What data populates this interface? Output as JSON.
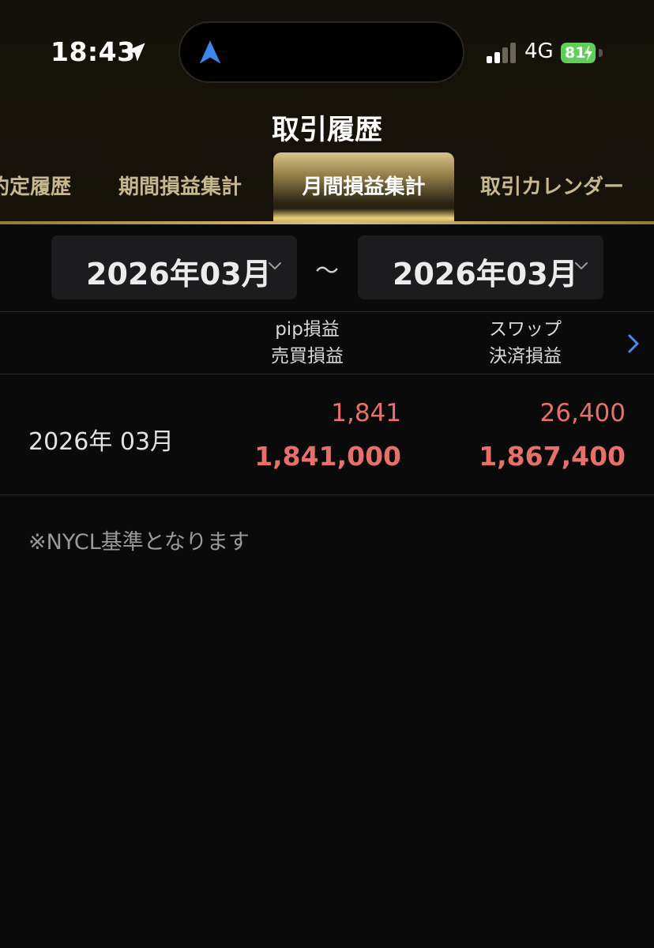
{
  "status_bar": {
    "time": "18:43",
    "network": "4G",
    "battery": "81"
  },
  "header": {
    "title": "取引履歴"
  },
  "tabs": [
    {
      "label": "約定履歴"
    },
    {
      "label": "期間損益集計"
    },
    {
      "label": "月間損益集計",
      "active": true
    },
    {
      "label": "取引カレンダー"
    }
  ],
  "date_range": {
    "from": "2026年03月",
    "separator": "～",
    "to": "2026年03月"
  },
  "table": {
    "headers": {
      "col1_line1": "pip損益",
      "col1_line2": "売買損益",
      "col2_line1": "スワップ",
      "col2_line2": "決済損益"
    },
    "rows": [
      {
        "period": "2026年 03月",
        "pip": "1,841",
        "trade_pl": "1,841,000",
        "swap": "26,400",
        "settlement_pl": "1,867,400"
      }
    ]
  },
  "note": "※NYCL基準となります",
  "colors": {
    "accent_gold": "#d9c27a",
    "profit_red": "#e7706b",
    "battery_green": "#5fcf5a",
    "link_blue": "#4a8cf2"
  },
  "icons": [
    "location-arrow-icon",
    "navigation-icon",
    "signal-icon",
    "battery-icon",
    "chevron-down-icon",
    "chevron-right-icon"
  ]
}
